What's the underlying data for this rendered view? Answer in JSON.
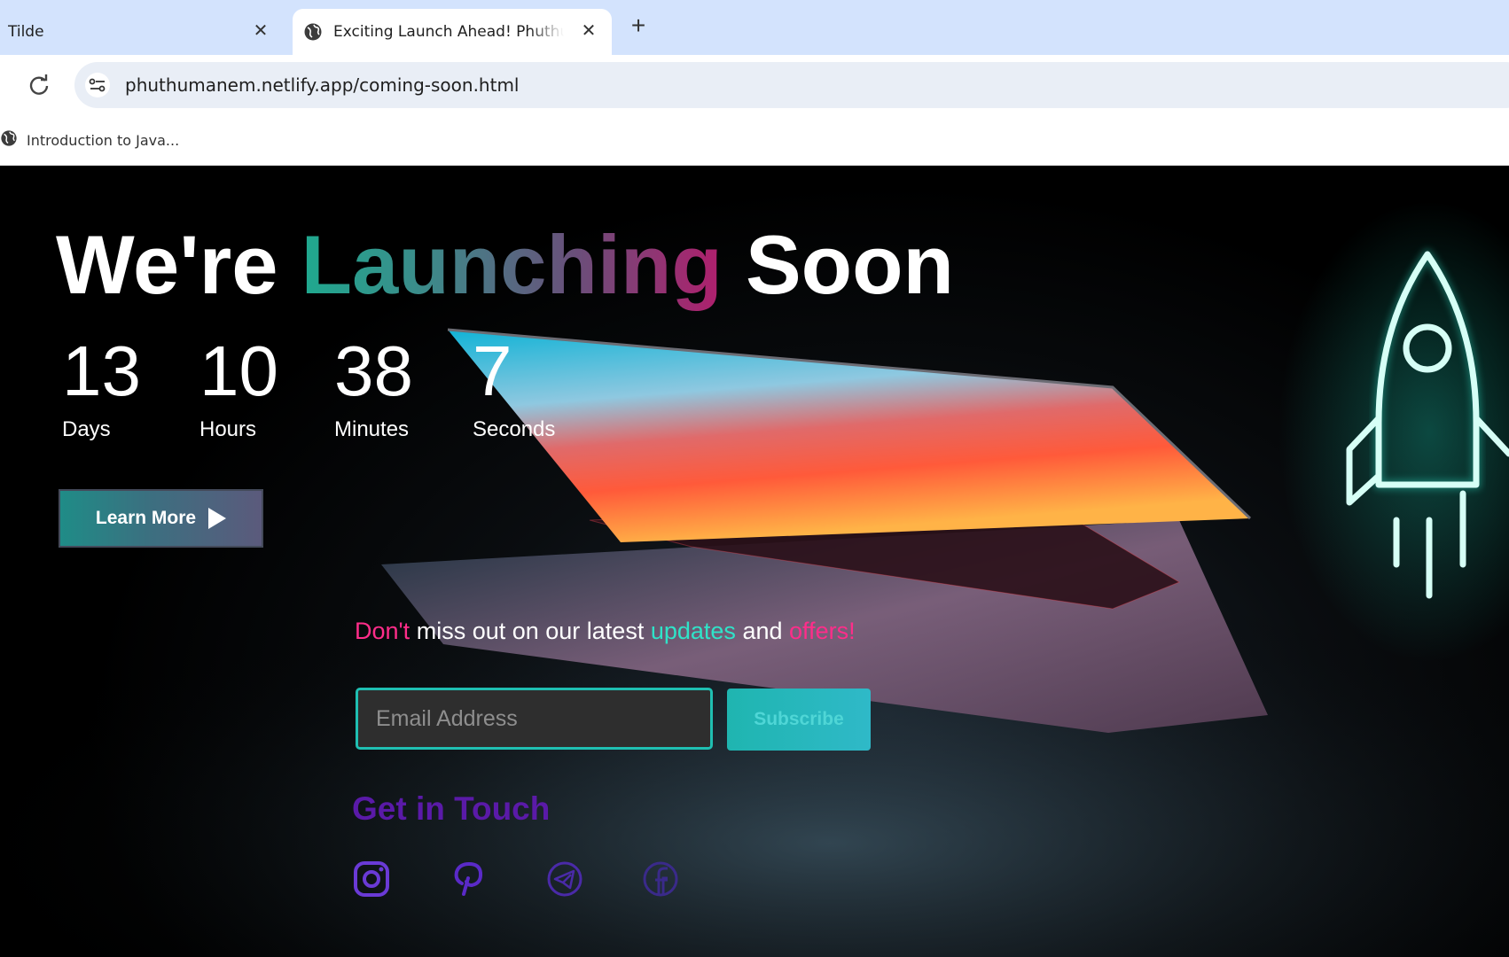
{
  "browser": {
    "tabs": [
      {
        "title": "Tilde",
        "active": false
      },
      {
        "title": "Exciting Launch Ahead! Phuthuma",
        "active": true
      }
    ],
    "url": "phuthumanem.netlify.app/coming-soon.html",
    "bookmarks": [
      {
        "label": "Introduction to Java..."
      }
    ],
    "icons": {
      "close": "close-icon",
      "new_tab": "plus-icon",
      "reload": "reload-icon",
      "site_info": "tune-icon",
      "favicon": "globe-icon"
    }
  },
  "hero": {
    "headline": {
      "before": "We're",
      "highlight": "Launching",
      "after": "Soon"
    },
    "countdown": [
      {
        "value": "13",
        "unit": "Days"
      },
      {
        "value": "10",
        "unit": "Hours"
      },
      {
        "value": "38",
        "unit": "Minutes"
      },
      {
        "value": "7",
        "unit": "Seconds"
      }
    ],
    "learn_more": "Learn More"
  },
  "newsletter": {
    "tagline": {
      "w1": "Don't",
      "w2": "miss out on our latest",
      "w3": "updates",
      "w4": "and",
      "w5": "offers!"
    },
    "email_placeholder": "Email Address",
    "subscribe": "Subscribe"
  },
  "contact": {
    "heading": "Get in Touch",
    "social": [
      "instagram-icon",
      "pinterest-icon",
      "telegram-icon",
      "facebook-icon"
    ]
  },
  "colors": {
    "accent_teal": "#1fbfb2",
    "accent_pink": "#ff2d8a",
    "heading_purple": "#5a1aa8",
    "tab_strip": "#d3e3fd"
  }
}
